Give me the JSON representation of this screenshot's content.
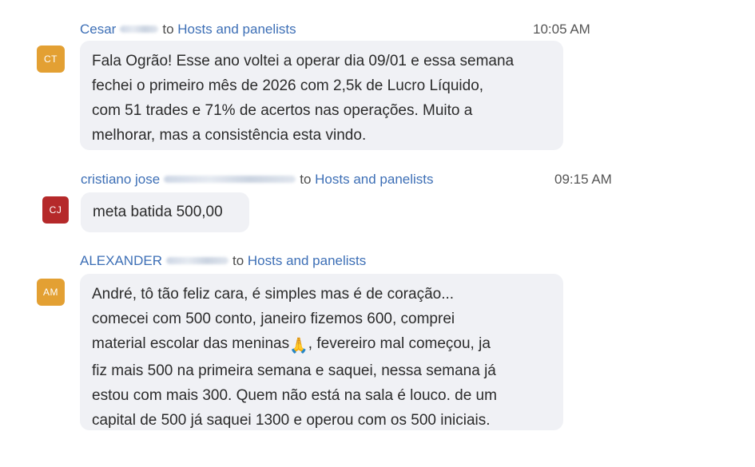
{
  "colors": {
    "link": "#3d6fb6",
    "bubble": "#f0f1f5",
    "avatar_orange": "#e3a033",
    "avatar_red": "#b5292a"
  },
  "messages": [
    {
      "sender": "Cesar",
      "to_word": "to",
      "target": "Hosts and panelists",
      "time": "10:05 AM",
      "initials": "CT",
      "lines": [
        "Fala Ogrão! Esse ano voltei a operar dia 09/01 e essa semana",
        "fechei o primeiro mês de 2026 com 2,5k de Lucro Líquido,",
        "com 51 trades e 71% de acertos nas operações. Muito a",
        "melhorar, mas a consistência esta vindo."
      ]
    },
    {
      "sender": "cristiano jose",
      "to_word": "to",
      "target": "Hosts and panelists",
      "time": "09:15 AM",
      "initials": "CJ",
      "lines": [
        "meta batida 500,00"
      ]
    },
    {
      "sender": "ALEXANDER",
      "to_word": "to",
      "target": "Hosts and panelists",
      "initials": "AM",
      "lines": [
        "André, tô tão feliz cara, é simples mas é de coração...",
        "comecei com 500 conto, janeiro fizemos 600, comprei",
        "material escolar das meninas",
        "fiz mais 500 na primeira semana e saquei, nessa semana já",
        "estou com mais 300. Quem não está na sala é louco. de um",
        "capital de 500 já saquei 1300 e operou com os 500 iniciais."
      ],
      "line3_tail": ", fevereiro mal começou, ja",
      "emoji": "🙏"
    }
  ]
}
